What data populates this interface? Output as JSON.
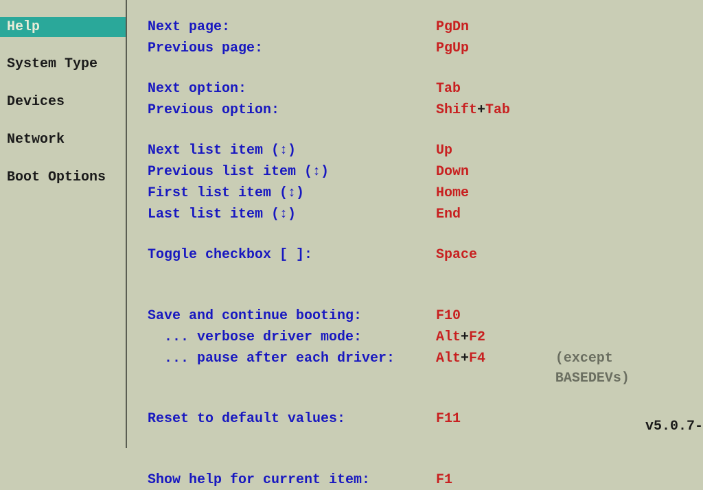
{
  "sidebar": {
    "items": [
      {
        "label": "Help",
        "selected": true
      },
      {
        "label": "System Type",
        "selected": false
      },
      {
        "label": "Devices",
        "selected": false
      },
      {
        "label": "Network",
        "selected": false
      },
      {
        "label": "Boot Options",
        "selected": false
      }
    ]
  },
  "help": {
    "next_page_label": "Next page:",
    "next_page_key": "PgDn",
    "prev_page_label": "Previous page:",
    "prev_page_key": "PgUp",
    "next_option_label": "Next option:",
    "next_option_key": "Tab",
    "prev_option_label": "Previous option:",
    "prev_option_key1": "Shift",
    "prev_option_plus": "+",
    "prev_option_key2": "Tab",
    "next_list_label": "Next list item (↕)",
    "next_list_key": "Up",
    "prev_list_label": "Previous list item (↕)",
    "prev_list_key": "Down",
    "first_list_label": "First list item (↕)",
    "first_list_key": "Home",
    "last_list_label": "Last list item (↕)",
    "last_list_key": "End",
    "toggle_label": "Toggle checkbox [ ]:",
    "toggle_key": "Space",
    "save_label": "Save and continue booting:",
    "save_key": "F10",
    "verbose_label": "  ... verbose driver mode:",
    "verbose_key1": "Alt",
    "verbose_plus": "+",
    "verbose_key2": "F2",
    "pause_label": "  ... pause after each driver:",
    "pause_key1": "Alt",
    "pause_plus": "+",
    "pause_key2": "F4",
    "pause_note": "(except BASEDEVs)",
    "reset_label": "Reset to default values:",
    "reset_key": "F11",
    "show_help_label": "Show help for current item:",
    "show_help_key": "F1"
  },
  "version": "v5.0.7-"
}
